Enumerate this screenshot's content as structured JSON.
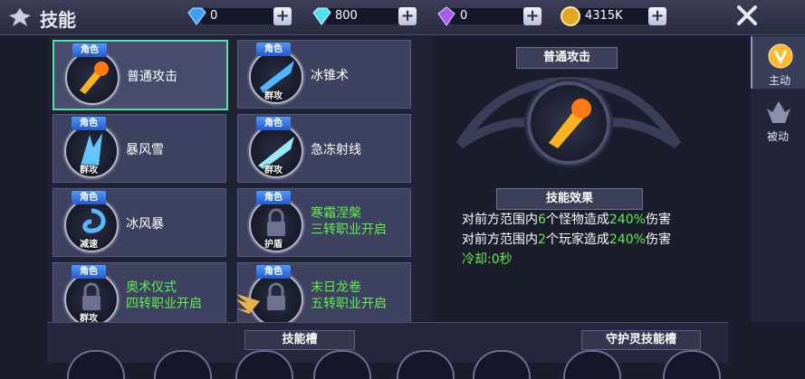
{
  "header": {
    "title": "技能",
    "currencies": [
      {
        "icon": "blue-diamond-icon",
        "value": "0"
      },
      {
        "icon": "cyan-diamond-icon",
        "value": "800"
      },
      {
        "icon": "purple-gem-icon",
        "value": "0"
      },
      {
        "icon": "gold-coin-icon",
        "value": "4315K"
      }
    ]
  },
  "skills": [
    {
      "tag": "角色",
      "name": "普通攻击",
      "sub": "",
      "locked": false,
      "selected": true
    },
    {
      "tag": "角色",
      "name": "冰锥术",
      "sub": "群攻",
      "locked": false,
      "selected": false
    },
    {
      "tag": "角色",
      "name": "暴风雪",
      "sub": "群攻",
      "locked": false,
      "selected": false
    },
    {
      "tag": "角色",
      "name": "急冻射线",
      "sub": "群攻",
      "locked": false,
      "selected": false
    },
    {
      "tag": "角色",
      "name": "冰风暴",
      "sub": "减速",
      "locked": false,
      "selected": false
    },
    {
      "tag": "角色",
      "name": "寒霜涅槃",
      "unlock": "三转职业开启",
      "sub": "护盾",
      "locked": true,
      "selected": false
    },
    {
      "tag": "角色",
      "name": "奥术仪式",
      "unlock": "四转职业开启",
      "sub": "群攻",
      "locked": true,
      "selected": false
    },
    {
      "tag": "角色",
      "name": "末日龙卷",
      "unlock": "五转职业开启",
      "sub": "",
      "locked": true,
      "selected": false
    }
  ],
  "detail": {
    "title": "普通攻击",
    "effect_header": "技能效果",
    "line1": {
      "a": "对前方范围内",
      "b": "6",
      "c": "个怪物造成",
      "d": "240%",
      "e": "伤害"
    },
    "line2": {
      "a": "对前方范围内",
      "b": "2",
      "c": "个玩家造成",
      "d": "240%",
      "e": "伤害"
    },
    "cooldown": "冷却:0秒"
  },
  "side_tabs": [
    {
      "label": "主动",
      "active": true
    },
    {
      "label": "被动",
      "active": false
    }
  ],
  "bottom": {
    "slot_label": "技能槽",
    "guardian_label": "守护灵技能槽"
  },
  "colors": {
    "highlight": "#5ff04a",
    "selected_border": "#56e0a9",
    "tag_blue": "#2f6fe0"
  }
}
